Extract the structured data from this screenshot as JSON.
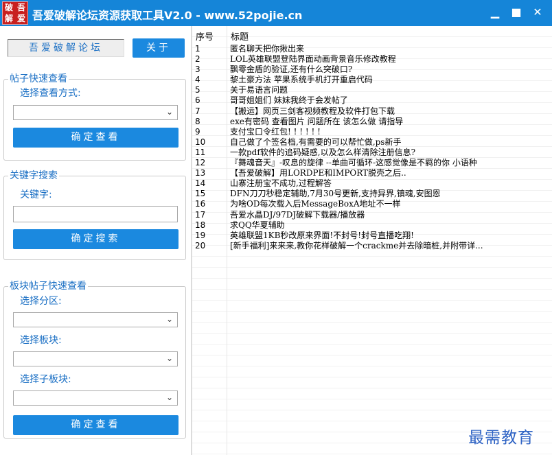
{
  "window": {
    "logo_chars": [
      "破",
      "吾",
      "解",
      "爱"
    ],
    "title": "吾爱破解论坛资源获取工具V2.0 - www.52pojie.cn",
    "min_icon": "minimize-icon",
    "max_icon": "maximize-icon",
    "close_icon": "close-icon",
    "accent": "#1585d8"
  },
  "top": {
    "forum_name": "吾爱破解论坛",
    "about_label": "关于"
  },
  "quick_view": {
    "title": "帖子快速查看",
    "method_label": "选择查看方式:",
    "method_value": "",
    "confirm_label": "确定查看"
  },
  "keyword_search": {
    "title": "关键字搜索",
    "keyword_label": "关键字:",
    "keyword_value": "",
    "search_label": "确定搜索"
  },
  "board_view": {
    "title": "板块帖子快速查看",
    "zone_label": "选择分区:",
    "zone_value": "",
    "board_label": "选择板块:",
    "board_value": "",
    "subboard_label": "选择子板块:",
    "subboard_value": "",
    "confirm_label": "确定查看"
  },
  "table": {
    "columns": [
      "序号",
      "标题"
    ],
    "rows": [
      {
        "no": "1",
        "title": "匿名聊天把你揪出来"
      },
      {
        "no": "2",
        "title": "LOL英雄联盟登陆界面动画背景音乐修改教程"
      },
      {
        "no": "3",
        "title": "飘零金盾的验证,还有什么突破口?"
      },
      {
        "no": "4",
        "title": "黎土豪方法 苹果系统手机打开重启代码"
      },
      {
        "no": "5",
        "title": "关于易语言问题"
      },
      {
        "no": "6",
        "title": "哥哥姐姐们 妹妹我终于会发帖了"
      },
      {
        "no": "7",
        "title": "【搬运】网页三剑客视频教程及软件打包下载"
      },
      {
        "no": "8",
        "title": "exe有密码  查看图片  问题所在  该怎么做 请指导"
      },
      {
        "no": "9",
        "title": "支付宝口令红包! ! ! ! ! !"
      },
      {
        "no": "10",
        "title": "自己做了个签名档,有需要的可以帮忙做,ps新手"
      },
      {
        "no": "11",
        "title": "一款pdf软件的追码疑惑,以及怎么样清除注册信息?"
      },
      {
        "no": "12",
        "title": "『舞魂音天』-叹息的旋律 --单曲可循环-这感觉像是不羁的你 小语种"
      },
      {
        "no": "13",
        "title": "【吾爱破解】用LORDPE和IMPORT脱壳之后.."
      },
      {
        "no": "14",
        "title": "山寨注册宝不成功,过程解答"
      },
      {
        "no": "15",
        "title": "DFN刀刀秒稳定辅助,7月30号更新,支持异界,镇魂,安图恩"
      },
      {
        "no": "16",
        "title": "为啥OD每次载入后MessageBoxA地址不一样"
      },
      {
        "no": "17",
        "title": "吾爱水晶DJ/97DJ破解下载器/播放器"
      },
      {
        "no": "18",
        "title": "求QQ华夏辅助"
      },
      {
        "no": "19",
        "title": "英雄联盟1KB秒改原来界面!不封号!封号直播吃翔!"
      },
      {
        "no": "20",
        "title": "[新手福利]来来来,教你花样破解一个crackme并去除暗桩,并附带详..."
      }
    ]
  },
  "watermark": "最需教育"
}
